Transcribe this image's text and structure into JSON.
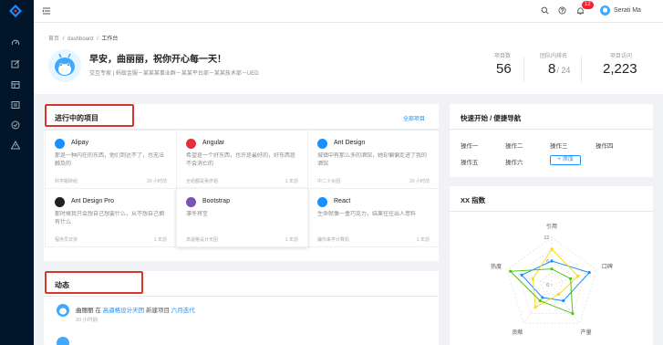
{
  "header": {
    "user_name": "Serati Ma",
    "notification_count": "12",
    "accent": "#1890ff",
    "sidebar_bg": "#001529",
    "highlight": "#d9362b"
  },
  "breadcrumb": [
    "首页",
    "dashboard",
    "工作台"
  ],
  "greeting": {
    "title": "早安，曲丽丽，祝你开心每一天！",
    "subtitle": "交互专家 | 蚂蚁金服－某某某事业群－某某平台部－某某技术部－UED"
  },
  "stats": [
    {
      "label": "项目数",
      "value": "56",
      "suffix": ""
    },
    {
      "label": "团队内排名",
      "value": "8",
      "suffix": "/ 24"
    },
    {
      "label": "项目访问",
      "value": "2,223",
      "suffix": ""
    }
  ],
  "projects": {
    "title": "进行中的项目",
    "all_link": "全部项目",
    "items": [
      {
        "name": "Alipay",
        "desc": "那是一种内在的东西，他们到达不了，也无法触及的",
        "group": "科学搬砖组",
        "time": "20 小时前",
        "icon_color": "#1890ff",
        "icon": "alipay-icon"
      },
      {
        "name": "Angular",
        "desc": "希望是一个好东西，也许是最好的，好东西是不会消亡的",
        "group": "全组都是吴彦祖",
        "time": "1 年前",
        "icon_color": "#e23237",
        "icon": "angular-icon"
      },
      {
        "name": "Ant Design",
        "desc": "城镇中有那么多的酒馆，她却偏偏走进了我的酒馆",
        "group": "中二少女团",
        "time": "20 小时前",
        "icon_color": "#1890ff",
        "icon": "ant-design-icon"
      },
      {
        "name": "Ant Design Pro",
        "desc": "那时候我只会想自己想要什么，从不想自己拥有什么",
        "group": "程序员日常",
        "time": "1 年前",
        "icon_color": "#222222",
        "icon": "ant-design-pro-icon"
      },
      {
        "name": "Bootstrap",
        "desc": "凛冬将至",
        "group": "高逼格设计天团",
        "time": "1 年前",
        "icon_color": "#7952b3",
        "icon": "bootstrap-icon"
      },
      {
        "name": "React",
        "desc": "生命就像一盒巧克力，结果往往出人意料",
        "group": "骗你来学计算机",
        "time": "1 年前",
        "icon_color": "#1890ff",
        "icon": "react-icon"
      }
    ]
  },
  "activity": {
    "title": "动态",
    "items": [
      {
        "user": "曲丽丽",
        "verb": "在",
        "group": "高逼格设计天团",
        "action": "新建项目",
        "project": "六月迭代",
        "time": "20 小时前"
      }
    ]
  },
  "quick": {
    "title": "快速开始 / 便捷导航",
    "items": [
      "操作一",
      "操作二",
      "操作三",
      "操作四",
      "操作五",
      "操作六"
    ],
    "add_label": "+ 添加"
  },
  "radar": {
    "title": "XX 指数",
    "axes": [
      "引用",
      "口碑",
      "产量",
      "贡献",
      "热度"
    ],
    "ticks": [
      "12",
      "6",
      "0"
    ]
  },
  "chart_data": {
    "type": "radar",
    "title": "XX 指数",
    "categories": [
      "引用",
      "口碑",
      "产量",
      "贡献",
      "热度"
    ],
    "range": [
      0,
      12
    ],
    "series": [
      {
        "values": [
          6,
          10,
          5,
          4,
          8
        ],
        "color": "#1890ff"
      },
      {
        "values": [
          9,
          7,
          3,
          7,
          5
        ],
        "color": "#fadb14"
      },
      {
        "values": [
          4,
          5,
          9,
          5,
          11
        ],
        "color": "#52c41a"
      }
    ]
  }
}
